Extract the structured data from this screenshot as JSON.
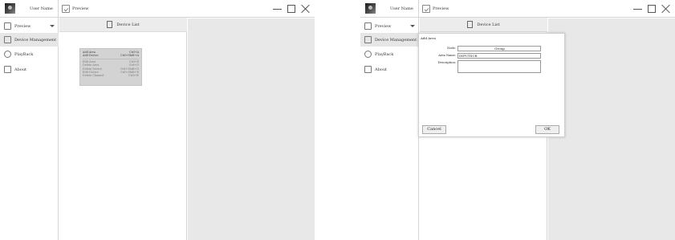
{
  "app": {
    "user_name": "User Name",
    "preview_tab_label": "Preview",
    "minimize_icon": "minimize-icon",
    "maximize_icon": "maximize-icon",
    "close_icon": "close-icon"
  },
  "sidebar": {
    "items": [
      {
        "label": "Preview",
        "icon": "monitor-icon"
      },
      {
        "label": "Device Management",
        "icon": "device-icon"
      },
      {
        "label": "PlayBack",
        "icon": "clock-icon"
      },
      {
        "label": "About",
        "icon": "info-icon"
      }
    ]
  },
  "device_list": {
    "header": "Device List"
  },
  "context_menu": {
    "items": [
      {
        "label": "Add Area",
        "shortcut": "Ctrl+A"
      },
      {
        "label": "Add Device",
        "shortcut": "Ctrl+Shift+A"
      },
      {
        "label": "Edit Area",
        "shortcut": "Ctrl+E"
      },
      {
        "label": "Delete Area",
        "shortcut": "Ctrl+D"
      },
      {
        "label": "Delete Device",
        "shortcut": "Ctrl+Shift+D"
      },
      {
        "label": "Edit Device",
        "shortcut": "Ctrl+Shift+E"
      },
      {
        "label": "Delete Channel",
        "shortcut": "Ctrl+W"
      }
    ]
  },
  "dialog": {
    "title": "Add Area",
    "fields": [
      {
        "label": "Node:",
        "value": "Group"
      },
      {
        "label": "Area Name:",
        "value": "INPUTSCR"
      },
      {
        "label": "Description:",
        "value": ""
      }
    ],
    "cancel_label": "Cancel",
    "ok_label": "OK"
  }
}
